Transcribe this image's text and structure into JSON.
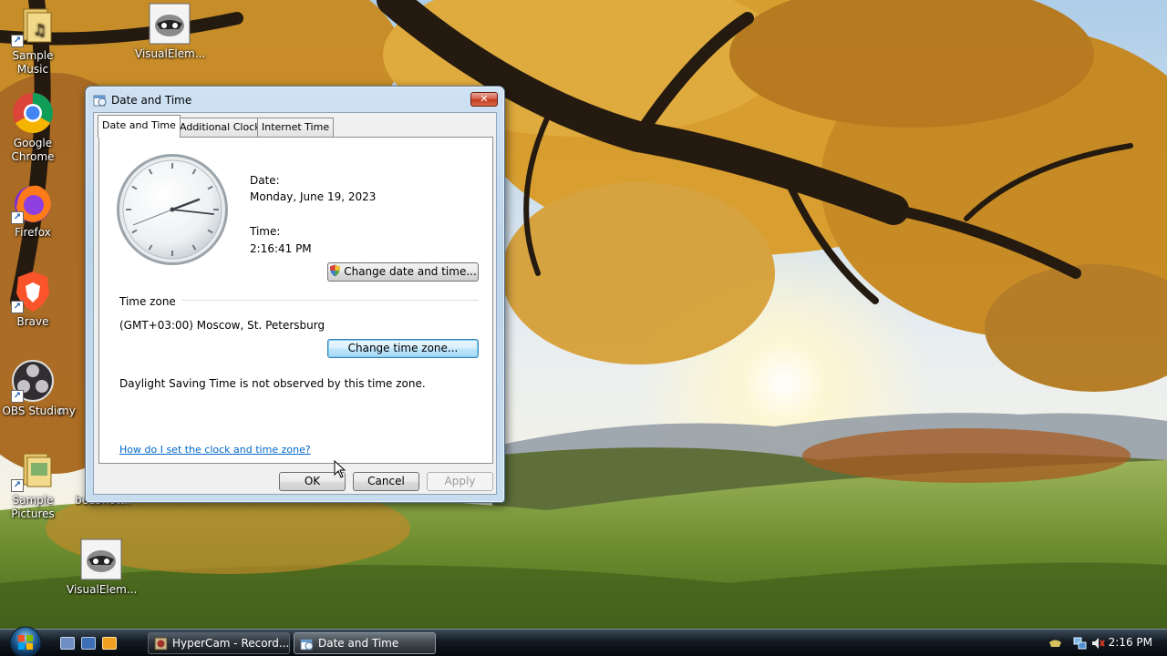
{
  "desktop": {
    "icons": [
      {
        "label": "Sample Music"
      },
      {
        "label": "Google Chrome"
      },
      {
        "label": "Firefox"
      },
      {
        "label": "Brave"
      },
      {
        "label": "OBS Studio"
      },
      {
        "label": "Sample Pictures"
      },
      {
        "label": "VisualElem..."
      },
      {
        "label": "VisualElem..."
      }
    ],
    "partial_labels": [
      "my",
      "bee3hott..."
    ]
  },
  "dialog": {
    "title": "Date and Time",
    "close_label": "✕",
    "tabs": [
      {
        "label": "Date and Time",
        "active": true
      },
      {
        "label": "Additional Clocks",
        "active": false
      },
      {
        "label": "Internet Time",
        "active": false
      }
    ],
    "date_label": "Date:",
    "date_value": "Monday, June 19, 2023",
    "time_label": "Time:",
    "time_value": "2:16:41 PM",
    "change_datetime_label": "Change date and time...",
    "timezone_heading": "Time zone",
    "timezone_value": "(GMT+03:00) Moscow, St. Petersburg",
    "change_timezone_label": "Change time zone...",
    "dst_note": "Daylight Saving Time is not observed by this time zone.",
    "help_link": "How do I set the clock and time zone?",
    "ok_label": "OK",
    "cancel_label": "Cancel",
    "apply_label": "Apply"
  },
  "taskbar": {
    "tasks": [
      {
        "label": "HyperCam - Record...",
        "active": false
      },
      {
        "label": "Date and Time",
        "active": true
      }
    ],
    "clock": "2:16 PM"
  }
}
